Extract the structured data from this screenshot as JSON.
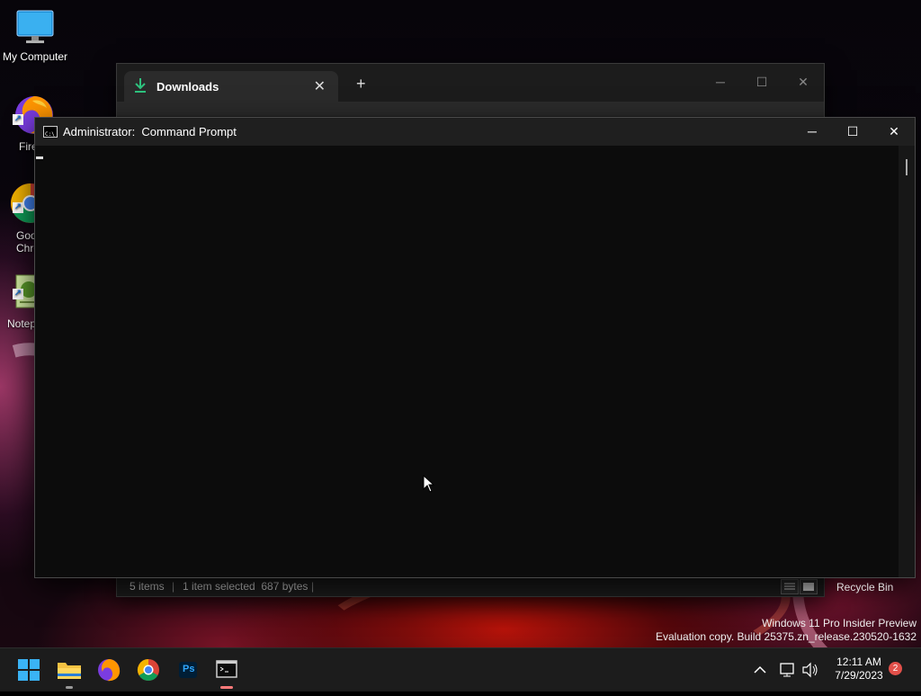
{
  "desktop": {
    "icons": [
      {
        "label": "My Computer"
      },
      {
        "label": "Fire"
      },
      {
        "label": "Goo\nChro"
      },
      {
        "label": "Notep"
      }
    ],
    "recycle_bin": "Recycle Bin",
    "watermark": {
      "line1": "Windows 11 Pro Insider Preview",
      "line2": "Evaluation copy. Build 25375.zn_release.230520-1632"
    }
  },
  "explorer": {
    "tab_label": "Downloads",
    "new_tab": "+",
    "tab_close": "✕",
    "status": {
      "items": "5 items",
      "selected": "1 item selected  687 bytes",
      "sep": "|"
    }
  },
  "cmd": {
    "title": "Administrator:  Command Prompt",
    "min": "─",
    "max": "☐",
    "close": "✕"
  },
  "taskbar": {
    "apps": [
      {
        "name": "start"
      },
      {
        "name": "file-explorer",
        "running": true
      },
      {
        "name": "firefox"
      },
      {
        "name": "chrome"
      },
      {
        "name": "photoshop",
        "label": "Ps"
      },
      {
        "name": "command-prompt",
        "running": true,
        "active": true
      }
    ],
    "clock": {
      "time": "12:11 AM",
      "date": "7/29/2023"
    },
    "notifications": "2"
  },
  "colors": {
    "accent": "#00a86b",
    "cmd_bg": "#0c0c0c",
    "taskbar_bg": "#1c1c1c",
    "notif_badge": "#e2504a"
  }
}
